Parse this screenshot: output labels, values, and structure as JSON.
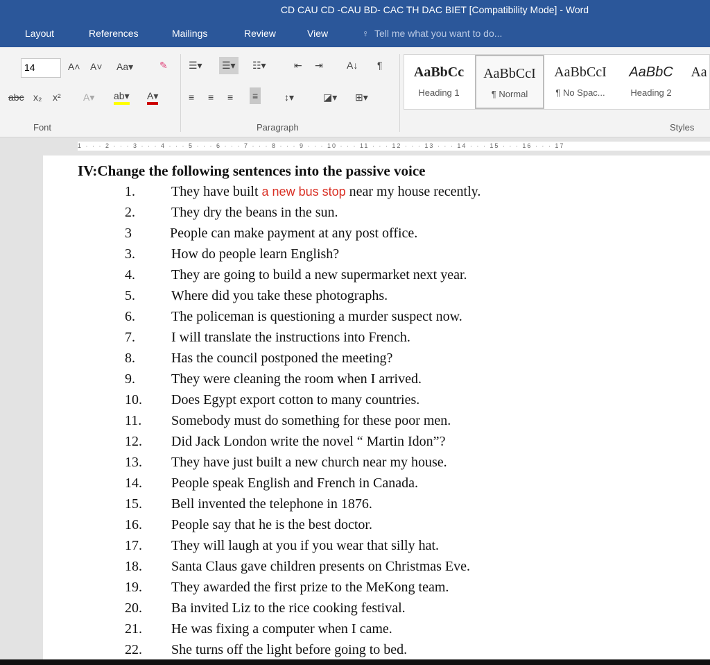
{
  "title": "CD CAU CD -CAU BD- CAC TH DAC BIET [Compatibility Mode] - Word",
  "tabs": [
    "Layout",
    "References",
    "Mailings",
    "Review",
    "View"
  ],
  "tell_me": "Tell me what you want to do...",
  "ribbon": {
    "font_size": "14",
    "font_group": "Font",
    "paragraph_group": "Paragraph",
    "styles_group": "Styles",
    "styles": [
      {
        "sample": "AaBbCc",
        "name": "Heading 1"
      },
      {
        "sample": "AaBbCcI",
        "name": "¶ Normal"
      },
      {
        "sample": "AaBbCcI",
        "name": "¶ No Spac..."
      },
      {
        "sample": "AaBbC",
        "name": "Heading 2"
      },
      {
        "sample": "Aa",
        "name": ""
      }
    ]
  },
  "ruler": "1 · · · 2 · · · 3 · · · 4 · · · 5 · · · 6 · · · 7 · · · 8 · · · 9 · · · 10 · · · 11 · · · 12 · · · 13 · · · 14 · · · 15 · · · 16 · · · 17",
  "doc": {
    "heading": "IV:Change the following sentences into the passive voice",
    "first": {
      "num": "1.",
      "pre": "They have built ",
      "red": "a new bus stop",
      "post": " near my house recently."
    },
    "items": [
      {
        "num": "2.",
        "text": "They dry the beans in the sun."
      },
      {
        "num": "3",
        "text": "People can make payment at any  post office."
      },
      {
        "num": "3.",
        "text": "How do people learn English?"
      },
      {
        "num": "4.",
        "text": "They are going to build a new supermarket next year."
      },
      {
        "num": "5.",
        "text": "Where did you take these photographs."
      },
      {
        "num": "6.",
        "text": "The policeman is questioning a murder suspect now."
      },
      {
        "num": "7.",
        "text": "I will translate the instructions into French."
      },
      {
        "num": "8.",
        "text": "Has the council postponed the meeting?"
      },
      {
        "num": "9.",
        "text": "They were cleaning the room when I arrived."
      },
      {
        "num": "10.",
        "text": "Does Egypt export cotton to many countries."
      },
      {
        "num": "11.",
        "text": "Somebody must do something for these poor men."
      },
      {
        "num": "12.",
        "text": "Did Jack London write the novel “ Martin Idon”?"
      },
      {
        "num": "13.",
        "text": "They have just built a new church near my house."
      },
      {
        "num": "14.",
        "text": "People speak English and French in Canada."
      },
      {
        "num": "15.",
        "text": "Bell invented the telephone in 1876."
      },
      {
        "num": "16.",
        "text": "People say that he is the best doctor."
      },
      {
        "num": "17.",
        "text": "They will laugh at you if you wear that silly hat."
      },
      {
        "num": "18.",
        "text": "Santa Claus gave children presents on Christmas Eve."
      },
      {
        "num": "19.",
        "text": "They awarded the first prize to the MeKong team."
      },
      {
        "num": "20.",
        "text": "Ba invited Liz to the rice cooking festival."
      },
      {
        "num": "21.",
        "text": "He was fixing a computer when I came."
      },
      {
        "num": "22.",
        "text": "She turns off the light before going to bed."
      }
    ]
  }
}
